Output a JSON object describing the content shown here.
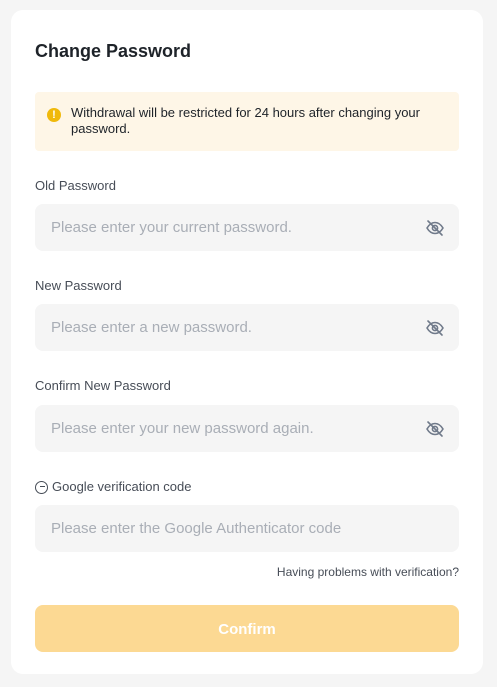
{
  "title": "Change Password",
  "notice": {
    "icon": "warning-icon",
    "text": "Withdrawal will be restricted for 24 hours after changing your password.",
    "color": "#f0b90b",
    "background": "#fef6e7"
  },
  "fields": {
    "old_password": {
      "label": "Old Password",
      "placeholder": "Please enter your current password.",
      "value": "",
      "toggle_icon": "eye-off-icon"
    },
    "new_password": {
      "label": "New Password",
      "placeholder": "Please enter a new password.",
      "value": "",
      "toggle_icon": "eye-off-icon"
    },
    "confirm_password": {
      "label": "Confirm New Password",
      "placeholder": "Please enter your new password again.",
      "value": "",
      "toggle_icon": "eye-off-icon"
    },
    "google_code": {
      "label": "Google verification code",
      "label_icon": "google-icon",
      "placeholder": "Please enter the Google Authenticator code",
      "value": ""
    }
  },
  "help_link": "Having problems with verification?",
  "confirm_button": {
    "label": "Confirm",
    "state": "disabled",
    "color": "#fcd993"
  }
}
